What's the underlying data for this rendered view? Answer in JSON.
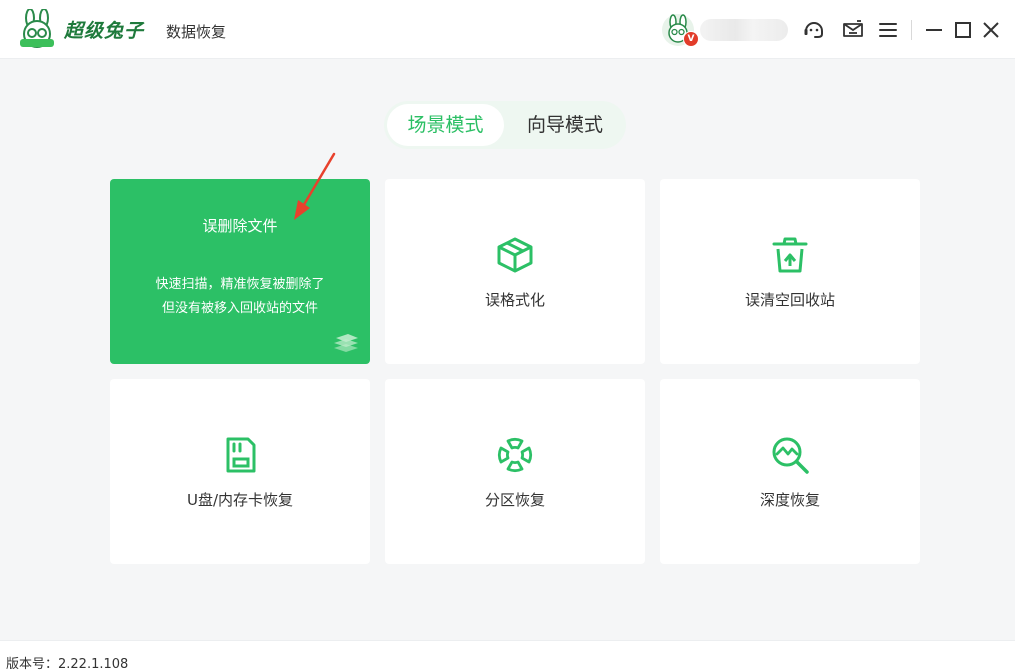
{
  "header": {
    "brand_name": "超级兔子",
    "product_name": "数据恢复",
    "vip_badge": "V"
  },
  "modes": {
    "scene": "场景模式",
    "guide": "向导模式",
    "active": "scene"
  },
  "cards": [
    {
      "title": "误删除文件",
      "desc_line1": "快速扫描，精准恢复被删除了",
      "desc_line2": "但没有被移入回收站的文件",
      "icon": "stack-icon"
    },
    {
      "title": "误格式化",
      "icon": "cube-icon"
    },
    {
      "title": "误清空回收站",
      "icon": "recycle-bin-icon"
    },
    {
      "title": "U盘/内存卡恢复",
      "icon": "sd-card-icon"
    },
    {
      "title": "分区恢复",
      "icon": "partition-icon"
    },
    {
      "title": "深度恢复",
      "icon": "deep-scan-icon"
    }
  ],
  "footer": {
    "version_text": "版本号：2.22.1.108"
  },
  "colors": {
    "accent": "#2cc066",
    "accent_text": "#2bbf64",
    "arrow": "#e8412c"
  }
}
